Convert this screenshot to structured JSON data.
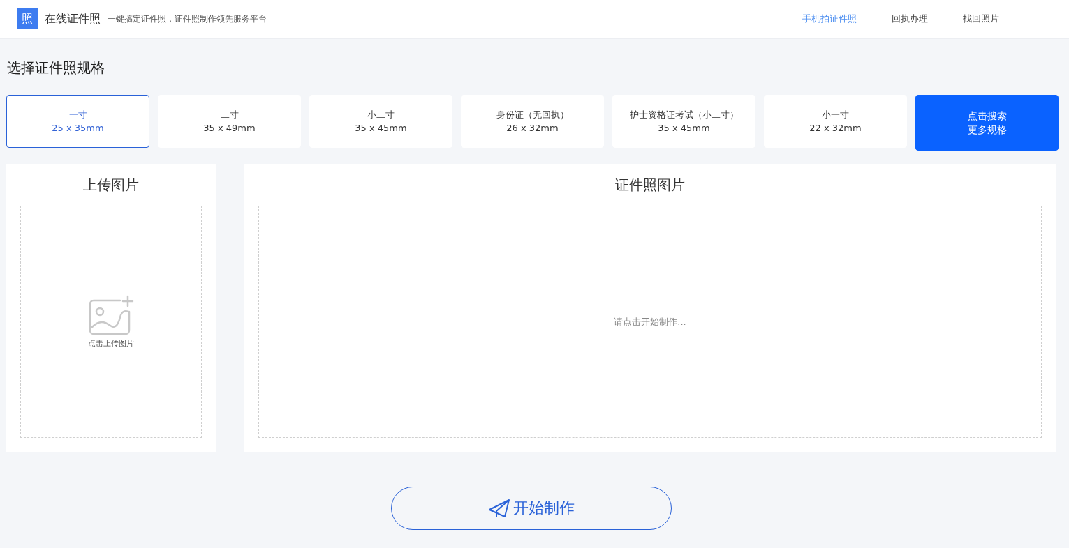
{
  "header": {
    "logo_glyph": "照",
    "site_name": "在线证件照",
    "slogan": "一键搞定证件照，证件照制作领先服务平台",
    "nav": [
      {
        "label": "手机拍证件照",
        "selected": true
      },
      {
        "label": "回执办理",
        "selected": false
      },
      {
        "label": "找回照片",
        "selected": false
      }
    ]
  },
  "section_title": "选择证件照规格",
  "specs": [
    {
      "kind": "size",
      "name": "一寸",
      "size": "25 x 35mm",
      "selected": true
    },
    {
      "kind": "size",
      "name": "二寸",
      "size": "35 x 49mm",
      "selected": false
    },
    {
      "kind": "size",
      "name": "小二寸",
      "size": "35 x 45mm",
      "selected": false
    },
    {
      "kind": "size",
      "name": "身份证（无回执）",
      "size": "26 x 32mm",
      "selected": false
    },
    {
      "kind": "size",
      "name": "护士资格证考试（小二寸）",
      "size": "35 x 45mm",
      "selected": false
    },
    {
      "kind": "size",
      "name": "小一寸",
      "size": "22 x 32mm",
      "selected": false
    },
    {
      "kind": "more",
      "name": "点击搜索",
      "size": "更多规格"
    }
  ],
  "upload": {
    "title": "上传图片",
    "hint": "点击上传图片"
  },
  "result": {
    "title": "证件照图片",
    "hint": "请点击开始制作..."
  },
  "start_button": "开始制作"
}
